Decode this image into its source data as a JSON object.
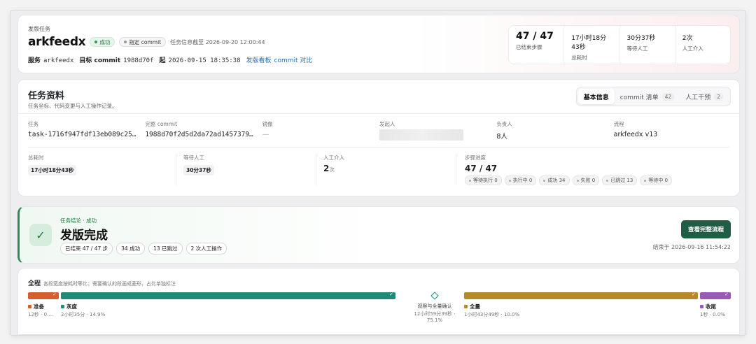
{
  "header": {
    "kicker": "发版任务",
    "app_name": "arkfeedx",
    "status_pill": "成功",
    "commit_pill": "指定 commit",
    "as_of": "任务信息截至 2026-09-20 12:00:44",
    "service_label": "服务",
    "service_value": "arkfeedx",
    "target_label": "目标 commit",
    "target_value": "1988d70f",
    "start_label": "起",
    "start_value": "2026-09-15 18:35:38",
    "board_link": "发版看板",
    "compare_link": "commit 对比",
    "stats": [
      {
        "value": "47 / 47",
        "label": "已结束步骤"
      },
      {
        "value": "17小时18分43秒",
        "label": "总耗时"
      },
      {
        "value": "30分37秒",
        "label": "等待人工"
      },
      {
        "value": "2次",
        "label": "人工介入"
      }
    ]
  },
  "info": {
    "title": "任务资料",
    "subtitle": "任务坐标、代码变更与人工操作记录。",
    "tabs": [
      {
        "label": "基本信息",
        "count": ""
      },
      {
        "label": "commit 清单",
        "count": "42"
      },
      {
        "label": "人工干预",
        "count": "2"
      }
    ],
    "fields": {
      "task_label": "任务",
      "task_value": "task-1716f947fdf13eb089c25…",
      "commit_label": "完整 commit",
      "commit_value": "1988d70f2d5d2da72ad1457379…",
      "image_label": "镜像",
      "image_value": "—",
      "initiator_label": "发起人",
      "owner_label": "负责人",
      "owner_value": "8人",
      "flow_label": "流程",
      "flow_value": "arkfeedx v13"
    },
    "metrics": {
      "total_label": "总耗时",
      "total_value": "17小时18分43秒",
      "wait_label": "等待人工",
      "wait_value": "30分37秒",
      "manual_label": "人工介入",
      "manual_num": "2",
      "manual_unit": "次",
      "progress_label": "步骤进度",
      "progress_value": "47 / 47",
      "progress_chips": [
        "等待执行 0",
        "执行中 0",
        "成功 34",
        "失败 0",
        "已跳过 13",
        "等待中 0"
      ]
    }
  },
  "result": {
    "kicker": "任务结论 · 成功",
    "title": "发版完成",
    "chips": [
      "已结束 47 / 47 步",
      "34 成功",
      "13 已跳过",
      "2 次人工操作"
    ],
    "button": "查看完整流程",
    "ended": "结束于 2026-09-16 11:54:22"
  },
  "timeline": {
    "title": "全程",
    "note": "各段宽度按耗时等比；需要确认的段画成菱形，占比单独标注",
    "segments": [
      {
        "name": "准备",
        "sub": "12秒 · 0.…",
        "color": "#d35f2e"
      },
      {
        "name": "灰度",
        "sub": "2小时35分 · 14.9%",
        "color": "#1f8a78"
      },
      {
        "name": "全量",
        "sub": "1小时43分49秒 · 10.0%",
        "color": "#b8892a"
      },
      {
        "name": "收尾",
        "sub": "1秒 · 0.0%",
        "color": "#9b59b6"
      }
    ],
    "milestone": {
      "name": "观察与全量确认",
      "sub1": "12小时59分39秒 ·",
      "sub2": "75.1%"
    }
  }
}
